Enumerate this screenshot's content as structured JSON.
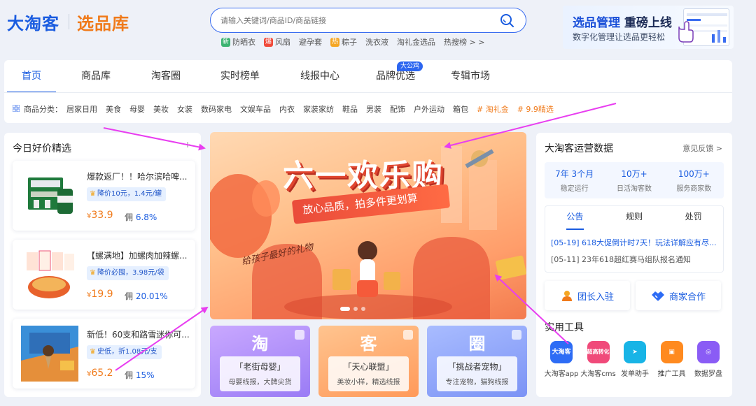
{
  "header": {
    "logo_main": "大淘客",
    "logo_sub": "选品库",
    "search_placeholder": "请输入关键词/商品ID/商品链接",
    "hot_words": [
      {
        "tag": "新",
        "tag_color": "#3cb371",
        "text": "防晒衣"
      },
      {
        "tag": "爆",
        "tag_color": "#f04a3a",
        "text": "风扇"
      },
      {
        "tag": "",
        "tag_color": "",
        "text": "避孕套"
      },
      {
        "tag": "热",
        "tag_color": "#f5a623",
        "text": "粽子"
      },
      {
        "tag": "",
        "tag_color": "",
        "text": "洗衣液"
      },
      {
        "tag": "",
        "tag_color": "",
        "text": "淘礼金选品"
      },
      {
        "tag": "",
        "tag_color": "",
        "text": "热搜榜 > >"
      }
    ],
    "promo": {
      "title_a": "选品管理",
      "title_b": "重磅上线",
      "subtitle": "数字化管理让选品更轻松"
    }
  },
  "nav": {
    "tabs": [
      {
        "label": "首页",
        "active": true
      },
      {
        "label": "商品库",
        "active": false
      },
      {
        "label": "淘客圈",
        "active": false
      },
      {
        "label": "实时榜单",
        "active": false
      },
      {
        "label": "线报中心",
        "active": false
      },
      {
        "label": "品牌优选",
        "active": false,
        "badge": "大公鸡"
      },
      {
        "label": "专辑市场",
        "active": false
      }
    ],
    "category_label": "商品分类：",
    "categories": [
      "居家日用",
      "美食",
      "母婴",
      "美妆",
      "女装",
      "数码家电",
      "文娱车品",
      "内衣",
      "家装家纺",
      "鞋品",
      "男装",
      "配饰",
      "户外运动",
      "箱包"
    ],
    "special_categories": [
      "# 淘礼金",
      "# 9.9精选"
    ]
  },
  "left": {
    "title": "今日好价精选",
    "more": "+",
    "products": [
      {
        "name": "爆款返厂！！哈尔滨哈啤...",
        "coupon": "降价10元，1.4元/罐",
        "price": "33.9",
        "commission_label": "佣",
        "commission": "6.8%"
      },
      {
        "name": "【螺满地】加螺肉加辣螺...",
        "coupon": "降价必囤，3.98元/袋",
        "price": "19.9",
        "commission_label": "佣",
        "commission": "20.01%"
      },
      {
        "name": "新低！60支和路雪迷你可...",
        "coupon": "史低，折1.08元/支",
        "price": "65.2",
        "commission_label": "佣",
        "commission": "15%"
      }
    ],
    "currency": "¥"
  },
  "banner": {
    "title": "六一欢乐购",
    "subtitle": "放心品质，拍多件更划算",
    "handwriting": "给孩子最好的礼物"
  },
  "features": [
    {
      "big": "淘",
      "title": "「老街母婴」",
      "desc": "母婴线报，大牌尖货",
      "bg": "linear-gradient(160deg,#c9a8ff,#9a7cf5)"
    },
    {
      "big": "客",
      "title": "「天心联盟」",
      "desc": "美妆小样，精选线报",
      "bg": "linear-gradient(160deg,#ffc48f,#ff9a5a)"
    },
    {
      "big": "圈",
      "title": "「挑战者宠物」",
      "desc": "专注宠物，猫狗线报",
      "bg": "linear-gradient(160deg,#a9bcff,#7b93f5)"
    }
  ],
  "right": {
    "title": "大淘客运营数据",
    "more": "意见反馈 >",
    "stats": [
      {
        "value": "7年 3个月",
        "label": "稳定运行"
      },
      {
        "value": "10万+",
        "label": "日活淘客数"
      },
      {
        "value": "100万+",
        "label": "服务商家数"
      }
    ],
    "notice_tabs": [
      {
        "label": "公告",
        "active": true
      },
      {
        "label": "规则",
        "active": false
      },
      {
        "label": "处罚",
        "active": false
      }
    ],
    "notices": [
      "[05-19] 618大促倒计时7天！玩法详解应有尽...",
      "[05-11] 23年618超红赛马组队报名通知"
    ],
    "buttons": [
      {
        "label": "团长入驻"
      },
      {
        "label": "商家合作"
      }
    ],
    "tools_title": "实用工具",
    "tools": [
      {
        "name": "大淘客app",
        "icon_text": "大淘客",
        "color": "#2d6cf5"
      },
      {
        "name": "大淘客cms",
        "icon_text": "超高转化",
        "color": "#f04a7a"
      },
      {
        "name": "发单助手",
        "icon_text": "",
        "color": "#18b4e6"
      },
      {
        "name": "推广工具",
        "icon_text": "",
        "color": "#ff8a1f"
      },
      {
        "name": "数据罗盘",
        "icon_text": "",
        "color": "#8a5cf5"
      }
    ]
  }
}
